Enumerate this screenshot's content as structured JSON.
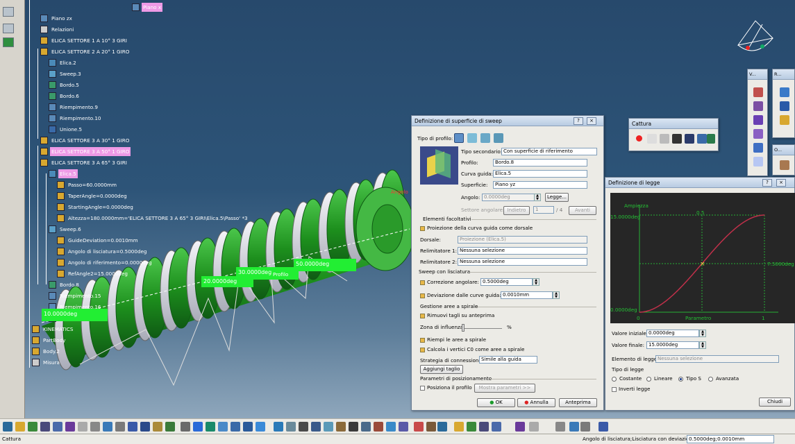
{
  "tree": {
    "nodes": [
      {
        "label": "Piano x",
        "hl": true
      },
      {
        "label": "Piano zx"
      },
      {
        "label": "Relazioni"
      },
      {
        "label": "ELICA SETTORE 1 A 10° 3 GIRI"
      },
      {
        "label": "ELICA SETTORE 2 A 20° 1 GIRO"
      },
      {
        "label": "Elica.2"
      },
      {
        "label": "Sweep.3"
      },
      {
        "label": "Bordo.5"
      },
      {
        "label": "Bordo.6"
      },
      {
        "label": "Riempimento.9"
      },
      {
        "label": "Riempimento.10"
      },
      {
        "label": "Unione.5"
      },
      {
        "label": "ELICA SETTORE 3 A 30° 1 GIRO"
      },
      {
        "label": "ELICA SETTORE 3 A 50° 1 GIRO",
        "hl": true
      },
      {
        "label": "ELICA SETTORE 3 A 65° 3 GIRI"
      },
      {
        "label": "Elica.5",
        "hl": true
      },
      {
        "label": "Passo=60.0000mm"
      },
      {
        "label": "TaperAngle=0.0000deg"
      },
      {
        "label": "StartingAngle=0.0000deg"
      },
      {
        "label": "Altezza=180.0000mm='ELICA SETTORE 3 A 65° 3 GIRI\\Elica.5\\Passo' *3"
      },
      {
        "label": "Sweep.6"
      },
      {
        "label": "GuideDeviation=0.0010mm"
      },
      {
        "label": "Angolo di lisciatura=0.5000deg"
      },
      {
        "label": "Angolo di riferimento=0.0000deg"
      },
      {
        "label": "RefAngle2=15.0000deg"
      },
      {
        "label": "Bordo.8"
      },
      {
        "label": "Riempimento.15"
      },
      {
        "label": "Riempimento.16"
      },
      {
        "label": "Unione.6"
      },
      {
        "label": "KINEMATICS"
      },
      {
        "label": "PartBody"
      },
      {
        "label": "Body.2"
      },
      {
        "label": "Misura"
      }
    ]
  },
  "viewport": {
    "labels": [
      "20.0000deg",
      "30.0000deg",
      "50.0000deg",
      "10.0000deg",
      "Profilo",
      "Angolo"
    ]
  },
  "cattura": {
    "title": "Cattura"
  },
  "minitool": {
    "v_title": "V...",
    "r_title": "R...",
    "o_title": "O..."
  },
  "sweep": {
    "title": "Definizione di superficie di sweep",
    "help": "?",
    "close": "×",
    "tipo_profilo": "Tipo di profilo:",
    "tipo_secondario_label": "Tipo secondario:",
    "tipo_secondario_value": "Con superficie di riferimento",
    "profilo_label": "Profilo:",
    "profilo_value": "Bordo.8",
    "curva_guida_label": "Curva guida:",
    "curva_guida_value": "Elica.5",
    "superficie_label": "Superficie:",
    "superficie_value": "Piano yz",
    "angolo_label": "Angolo:",
    "angolo_value": "0.0000deg",
    "legge_button": "Legge...",
    "settore_label": "Settore angolare:",
    "indietro": "Indietro",
    "settore_value": "1",
    "settore_total": "/ 4",
    "avanti": "Avanti",
    "elementi_facoltativi": "Elementi facoltativi",
    "proiezione_dorsale": "Proiezione della curva guida come dorsale",
    "dorsale_label": "Dorsale:",
    "dorsale_value": "Proiezione (Elica.5)",
    "relim1_label": "Relimitatore 1:",
    "relim1_value": "Nessuna selezione",
    "relim2_label": "Relimitatore 2:",
    "relim2_value": "Nessuna selezione",
    "sweep_lisciatura": "Sweep con lisciatura",
    "correzione_label": "Correzione angolare:",
    "correzione_value": "0.5000deg",
    "deviazione_label": "Deviazione dalle curve guida:",
    "deviazione_value": "0.0010mm",
    "gestione_spirale": "Gestione aree a spirale",
    "rimuovi_tagli": "Rimuovi tagli su anteprima",
    "zona_influenza": "Zona di influenza:",
    "zona_unit": "%",
    "riempi_aree": "Riempi le aree a spirale",
    "calcola_vertici": "Calcola i vertici C0 come aree a spirale",
    "strategia_label": "Strategia di connessione:",
    "strategia_value": "Simile alla guida",
    "aggiungi_taglio": "Aggiungi taglio",
    "parametri_posizionamento": "Parametri di posizionamento",
    "posiziona_profilo": "Posiziona il profilo",
    "mostra_parametri": "Mostra parametri >>",
    "ok": "OK",
    "annulla": "Annulla",
    "anteprima": "Anteprima"
  },
  "legge": {
    "title": "Definizione di legge",
    "help": "?",
    "close": "×",
    "ampiezza": "Ampiezza",
    "y_top": "15.0000deg",
    "y_bottom": "0.0000deg",
    "y_mid_right": "7.5000deg",
    "x_mid_top": "0.5",
    "x_zero": "0",
    "x_one": "1",
    "parametro": "Parametro",
    "valore_iniziale_label": "Valore iniziale:",
    "valore_iniziale_value": "0.0000deg",
    "valore_finale_label": "Valore finale:",
    "valore_finale_value": "15.0000deg",
    "elemento_label": "Elemento di legge:",
    "elemento_value": "Nessuna selezione",
    "tipo_legge": "Tipo di legge",
    "costante": "Costante",
    "lineare": "Lineare",
    "tipo_s": "Tipo S",
    "avanzata": "Avanzata",
    "inverti_legge": "Inverti legge",
    "chiudi": "Chiudi"
  },
  "chart_data": {
    "type": "line",
    "xlabel": "Parametro",
    "ylabel": "Ampiezza",
    "xlim": [
      0,
      1
    ],
    "ylim": [
      0,
      15
    ],
    "series": [
      {
        "x": [
          0,
          0.1,
          0.2,
          0.3,
          0.4,
          0.5,
          0.6,
          0.7,
          0.8,
          0.9,
          1
        ],
        "values": [
          0,
          0.42,
          1.56,
          3.24,
          5.28,
          7.5,
          9.72,
          11.76,
          13.44,
          14.58,
          15
        ]
      }
    ]
  },
  "status": {
    "left": "Cattura",
    "right_label": "Angolo di lisciatura;Lisciatura con deviazione",
    "right_value": "0.5000deg;0.0010mm"
  },
  "colors": {
    "viewport_top": "#27496c",
    "highlight": "#ee9ae6",
    "green_labels": "#22ee33",
    "part_green": "#1f8f1f",
    "chart_bg": "#262626",
    "curve": "#c0304a",
    "grid": "#25b035"
  }
}
